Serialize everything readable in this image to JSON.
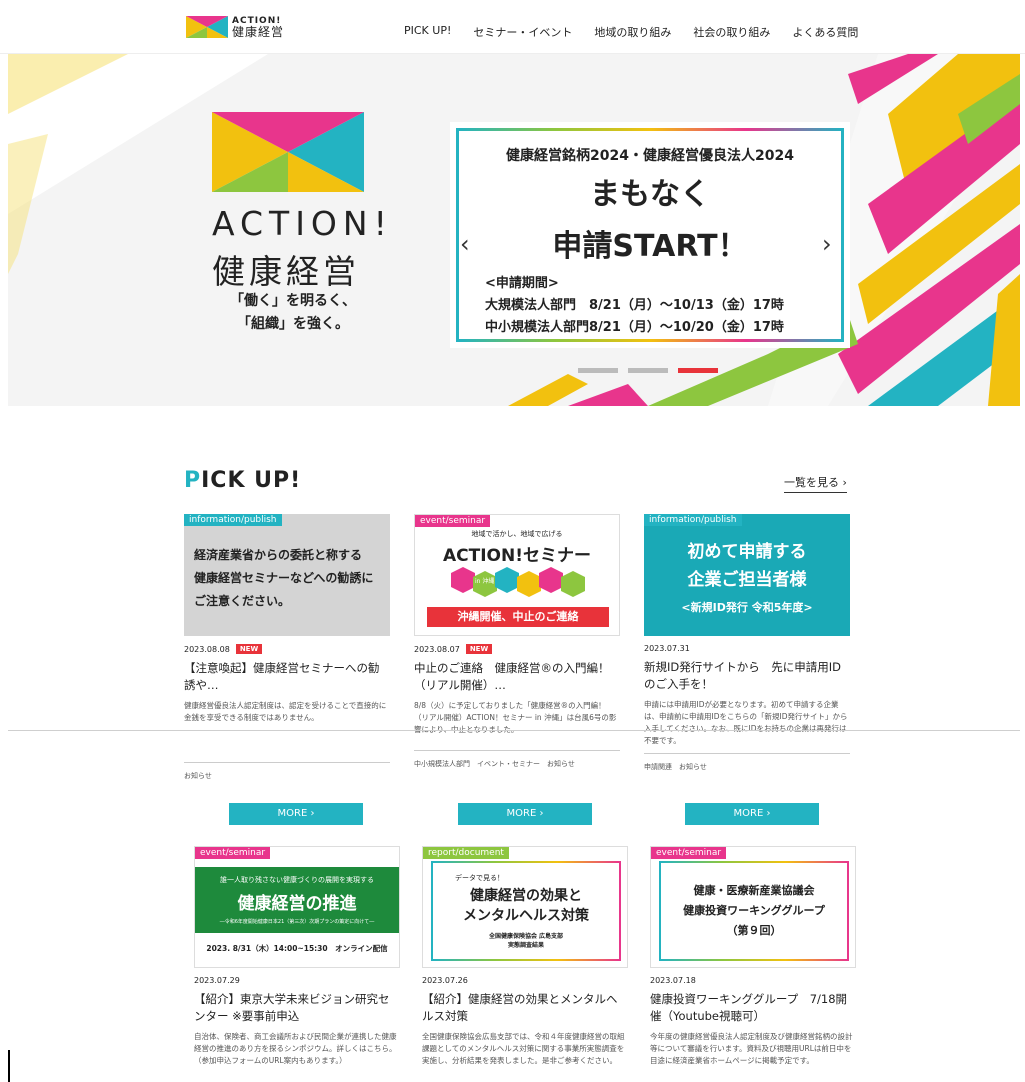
{
  "header": {
    "logo_line1": "ACTION!",
    "logo_line2": "健康経営",
    "nav": [
      "PICK UP!",
      "セミナー・イベント",
      "地域の取り組み",
      "社会の取り組み",
      "よくある質問"
    ]
  },
  "hero": {
    "logo_line1": "ACTION!",
    "logo_line2": "健康経営",
    "tagline_1": "「働く」を明るく、",
    "tagline_2": "「組織」を強く。",
    "banner": {
      "title": "健康経営銘柄2024・健康経営優良法人2024",
      "big1": "まもなく",
      "big2": "申請START！",
      "period_label": "<申請期間>",
      "period_1": "大規模法人部門　8/21（月）～10/13（金）17時",
      "period_2": "中小規模法人部門8/21（月）～10/20（金）17時"
    },
    "prev": "‹",
    "next": "›",
    "slides": 3,
    "active_slide": 3
  },
  "pickup": {
    "title_first": "P",
    "title_rest": "ICK UP!",
    "see_all": "一覧を見る ›",
    "more_label": "MORE ›",
    "cards": [
      {
        "category": "information/publish",
        "thumb_text": [
          "経済産業省からの委託と称する",
          "健康経営セミナーなどへの勧誘に",
          "ご注意ください。"
        ],
        "date": "2023.08.08",
        "new": "NEW",
        "title": "【注意喚起】健康経営セミナーへの勧誘や…",
        "desc": "健康経営優良法人認定制度は、認定を受けることで直接的に金銭を享受できる制度ではありません。",
        "tags": "お知らせ"
      },
      {
        "category": "event/seminar",
        "thumb_top": "地域で活かし、地域で広げる",
        "thumb_main": "ACTION!セミナー",
        "thumb_hex": "in 沖縄",
        "thumb_bottom": "沖縄開催、中止のご連絡",
        "date": "2023.08.07",
        "new": "NEW",
        "title": "中止のご連絡　健康経営®の入門編！（リアル開催）…",
        "desc": "8/8（火）に予定しておりました「健康経営®の入門編！（リアル開催）ACTION！セミナー in 沖縄」は台風6号の影響により、中止となりました。",
        "tags": "中小規模法人部門　イベント・セミナー　お知らせ"
      },
      {
        "category": "information/publish",
        "thumb_lines": [
          "初めて申請する",
          "企業ご担当者様",
          "<新規ID発行 令和5年度>"
        ],
        "date": "2023.07.31",
        "title": "新規ID発行サイトから　先に申請用IDのご入手を！",
        "desc": "申請には申請用IDが必要となります。初めて申請する企業は、申請前に申請用IDをこちらの「新規ID発行サイト」から入手してください。なお、既にIDをお持ちの企業は再発行は不要です。",
        "tags": "申請関連　お知らせ"
      },
      {
        "category": "event/seminar",
        "thumb_top": "誰一人取り残さない健康づくりの展開を実現する",
        "thumb_main": "健康経営の推進",
        "thumb_sub": "―令和6年度開始健康日本21（第三次）次期プランの策定に向けて―",
        "thumb_bottom": "2023. 8/31（木）14:00~15:30　オンライン配信",
        "date": "2023.07.29",
        "title": "【紹介】東京大学未来ビジョン研究センター ※要事前申込",
        "desc": "自治体、保険者、商工会議所および民間企業が連携した健康経営の推進のあり方を探るシンポジウム。詳しくはこちら。（参加申込フォームのURL案内もあります。）"
      },
      {
        "category": "report/document",
        "thumb_top": "データで見る！",
        "thumb_main1": "健康経営の効果と",
        "thumb_main2": "メンタルヘルス対策",
        "thumb_sub1": "全国健康保険協会 広島支部",
        "thumb_sub2": "実態調査結果",
        "date": "2023.07.26",
        "title": "【紹介】健康経営の効果とメンタルヘルス対策",
        "desc": "全国健康保険協会広島支部では、令和４年度健康経営の取組課題としてのメンタルヘルス対策に関する事業所実態調査を実施し、分析結果を発表しました。是非ご参考ください。"
      },
      {
        "category": "event/seminar",
        "thumb_lines": [
          "健康・医療新産業協議会",
          "健康投資ワーキンググループ",
          "（第９回）"
        ],
        "date": "2023.07.18",
        "title": "健康投資ワーキンググループ　7/18開催（Youtube視聴可）",
        "desc": "今年度の健康経営優良法人認定制度及び健康経営銘柄の設計等について審議を行います。資料及び視聴用URLは前日中を目途に経済産業省ホームページに掲載予定です。"
      }
    ]
  },
  "colors": {
    "accent": "#23b3c2",
    "new_badge": "#e8333a",
    "green": "#1e8a3c"
  }
}
